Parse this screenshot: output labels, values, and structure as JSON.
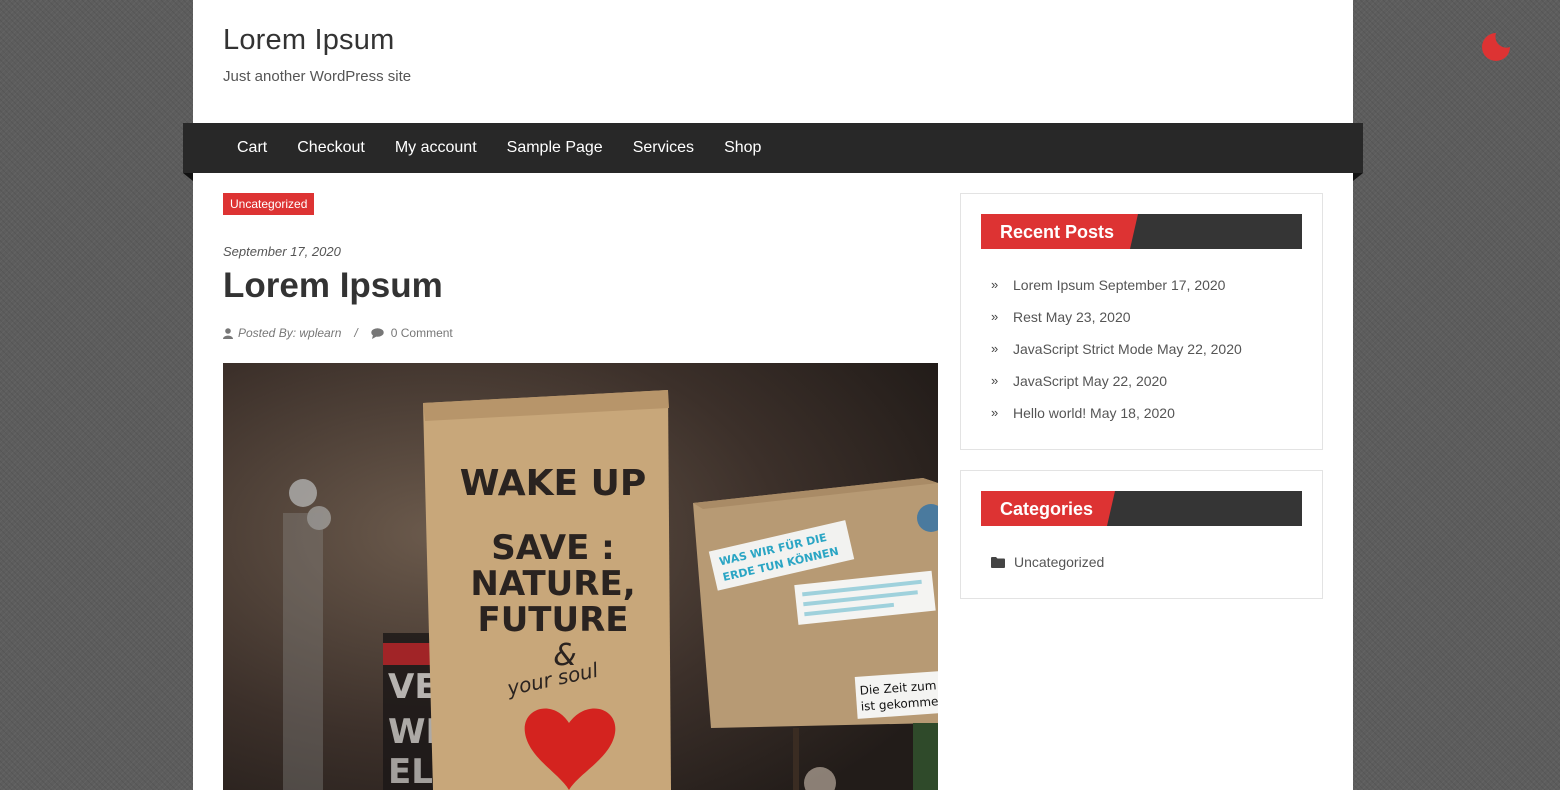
{
  "site": {
    "title": "Lorem Ipsum",
    "description": "Just another WordPress site"
  },
  "nav": {
    "items": [
      "Cart",
      "Checkout",
      "My account",
      "Sample Page",
      "Services",
      "Shop"
    ]
  },
  "theme_toggle": {
    "icon": "moon-icon",
    "color": "#dd3333"
  },
  "post": {
    "category": "Uncategorized",
    "date": "September 17, 2020",
    "title": "Lorem Ipsum",
    "posted_by": "Posted By: wplearn",
    "separator": "/",
    "comments": "0 Comment",
    "image": {
      "sign_main": [
        "WAKE UP",
        "SAVE :",
        "NATURE,",
        "FUTURE",
        "&",
        "your soul"
      ],
      "sign_right": [
        "WAS WIR FÜR DIE",
        "ERDE TUN KÖNNEN"
      ],
      "sign_right_bottom": [
        "Die Zeit zum",
        "ist gekomme"
      ]
    }
  },
  "sidebar": {
    "recent_posts": {
      "heading": "Recent Posts",
      "items": [
        {
          "title": "Lorem Ipsum",
          "date": "September 17, 2020"
        },
        {
          "title": "Rest",
          "date": "May 23, 2020"
        },
        {
          "title": "JavaScript Strict Mode",
          "date": "May 22, 2020"
        },
        {
          "title": "JavaScript",
          "date": "May 22, 2020"
        },
        {
          "title": "Hello world!",
          "date": "May 18, 2020"
        }
      ]
    },
    "categories": {
      "heading": "Categories",
      "items": [
        "Uncategorized"
      ]
    }
  },
  "colors": {
    "accent": "#dd3333",
    "nav_bg": "#282828",
    "widget_head_bg": "#353535"
  }
}
